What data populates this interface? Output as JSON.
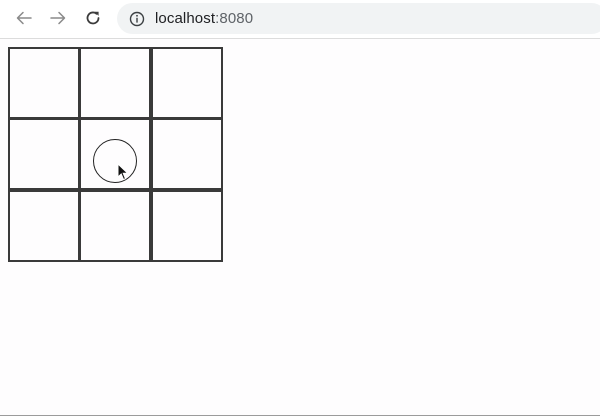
{
  "browser": {
    "url_host": "localhost",
    "url_port": ":8080",
    "icons": {
      "back": "back-arrow-icon",
      "forward": "forward-arrow-icon",
      "reload": "reload-icon",
      "info": "info-icon"
    }
  },
  "board": {
    "rows": 3,
    "cols": 3,
    "cells": [
      "",
      "",
      "",
      "",
      "O",
      "",
      "",
      "",
      ""
    ]
  },
  "colors": {
    "grid_line": "#3a3a3a",
    "address_bar": "#f1f3f4",
    "page_background": "#fefdfe"
  }
}
